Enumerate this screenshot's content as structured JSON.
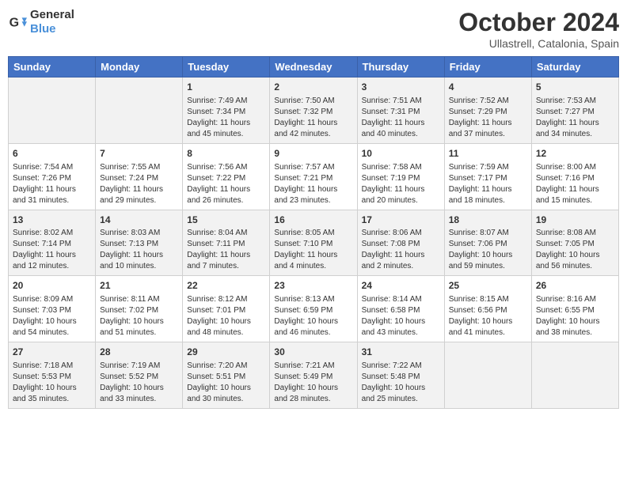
{
  "header": {
    "logo_line1": "General",
    "logo_line2": "Blue",
    "month": "October 2024",
    "location": "Ullastrell, Catalonia, Spain"
  },
  "days_of_week": [
    "Sunday",
    "Monday",
    "Tuesday",
    "Wednesday",
    "Thursday",
    "Friday",
    "Saturday"
  ],
  "weeks": [
    [
      {
        "day": "",
        "content": ""
      },
      {
        "day": "",
        "content": ""
      },
      {
        "day": "1",
        "content": "Sunrise: 7:49 AM\nSunset: 7:34 PM\nDaylight: 11 hours and 45 minutes."
      },
      {
        "day": "2",
        "content": "Sunrise: 7:50 AM\nSunset: 7:32 PM\nDaylight: 11 hours and 42 minutes."
      },
      {
        "day": "3",
        "content": "Sunrise: 7:51 AM\nSunset: 7:31 PM\nDaylight: 11 hours and 40 minutes."
      },
      {
        "day": "4",
        "content": "Sunrise: 7:52 AM\nSunset: 7:29 PM\nDaylight: 11 hours and 37 minutes."
      },
      {
        "day": "5",
        "content": "Sunrise: 7:53 AM\nSunset: 7:27 PM\nDaylight: 11 hours and 34 minutes."
      }
    ],
    [
      {
        "day": "6",
        "content": "Sunrise: 7:54 AM\nSunset: 7:26 PM\nDaylight: 11 hours and 31 minutes."
      },
      {
        "day": "7",
        "content": "Sunrise: 7:55 AM\nSunset: 7:24 PM\nDaylight: 11 hours and 29 minutes."
      },
      {
        "day": "8",
        "content": "Sunrise: 7:56 AM\nSunset: 7:22 PM\nDaylight: 11 hours and 26 minutes."
      },
      {
        "day": "9",
        "content": "Sunrise: 7:57 AM\nSunset: 7:21 PM\nDaylight: 11 hours and 23 minutes."
      },
      {
        "day": "10",
        "content": "Sunrise: 7:58 AM\nSunset: 7:19 PM\nDaylight: 11 hours and 20 minutes."
      },
      {
        "day": "11",
        "content": "Sunrise: 7:59 AM\nSunset: 7:17 PM\nDaylight: 11 hours and 18 minutes."
      },
      {
        "day": "12",
        "content": "Sunrise: 8:00 AM\nSunset: 7:16 PM\nDaylight: 11 hours and 15 minutes."
      }
    ],
    [
      {
        "day": "13",
        "content": "Sunrise: 8:02 AM\nSunset: 7:14 PM\nDaylight: 11 hours and 12 minutes."
      },
      {
        "day": "14",
        "content": "Sunrise: 8:03 AM\nSunset: 7:13 PM\nDaylight: 11 hours and 10 minutes."
      },
      {
        "day": "15",
        "content": "Sunrise: 8:04 AM\nSunset: 7:11 PM\nDaylight: 11 hours and 7 minutes."
      },
      {
        "day": "16",
        "content": "Sunrise: 8:05 AM\nSunset: 7:10 PM\nDaylight: 11 hours and 4 minutes."
      },
      {
        "day": "17",
        "content": "Sunrise: 8:06 AM\nSunset: 7:08 PM\nDaylight: 11 hours and 2 minutes."
      },
      {
        "day": "18",
        "content": "Sunrise: 8:07 AM\nSunset: 7:06 PM\nDaylight: 10 hours and 59 minutes."
      },
      {
        "day": "19",
        "content": "Sunrise: 8:08 AM\nSunset: 7:05 PM\nDaylight: 10 hours and 56 minutes."
      }
    ],
    [
      {
        "day": "20",
        "content": "Sunrise: 8:09 AM\nSunset: 7:03 PM\nDaylight: 10 hours and 54 minutes."
      },
      {
        "day": "21",
        "content": "Sunrise: 8:11 AM\nSunset: 7:02 PM\nDaylight: 10 hours and 51 minutes."
      },
      {
        "day": "22",
        "content": "Sunrise: 8:12 AM\nSunset: 7:01 PM\nDaylight: 10 hours and 48 minutes."
      },
      {
        "day": "23",
        "content": "Sunrise: 8:13 AM\nSunset: 6:59 PM\nDaylight: 10 hours and 46 minutes."
      },
      {
        "day": "24",
        "content": "Sunrise: 8:14 AM\nSunset: 6:58 PM\nDaylight: 10 hours and 43 minutes."
      },
      {
        "day": "25",
        "content": "Sunrise: 8:15 AM\nSunset: 6:56 PM\nDaylight: 10 hours and 41 minutes."
      },
      {
        "day": "26",
        "content": "Sunrise: 8:16 AM\nSunset: 6:55 PM\nDaylight: 10 hours and 38 minutes."
      }
    ],
    [
      {
        "day": "27",
        "content": "Sunrise: 7:18 AM\nSunset: 5:53 PM\nDaylight: 10 hours and 35 minutes."
      },
      {
        "day": "28",
        "content": "Sunrise: 7:19 AM\nSunset: 5:52 PM\nDaylight: 10 hours and 33 minutes."
      },
      {
        "day": "29",
        "content": "Sunrise: 7:20 AM\nSunset: 5:51 PM\nDaylight: 10 hours and 30 minutes."
      },
      {
        "day": "30",
        "content": "Sunrise: 7:21 AM\nSunset: 5:49 PM\nDaylight: 10 hours and 28 minutes."
      },
      {
        "day": "31",
        "content": "Sunrise: 7:22 AM\nSunset: 5:48 PM\nDaylight: 10 hours and 25 minutes."
      },
      {
        "day": "",
        "content": ""
      },
      {
        "day": "",
        "content": ""
      }
    ]
  ]
}
